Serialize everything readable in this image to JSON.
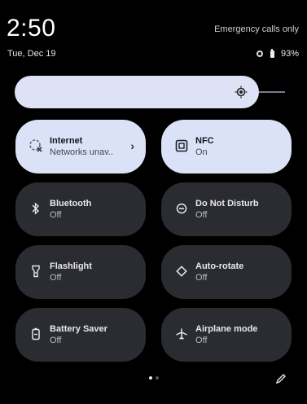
{
  "status": {
    "time": "2:50",
    "date": "Tue, Dec 19",
    "emergency": "Emergency calls only",
    "battery": "93%"
  },
  "brightness": {
    "level": 0.95
  },
  "tiles": [
    {
      "title": "Internet",
      "state": "Networks unav..",
      "active": true,
      "icon": "wifi-off-icon"
    },
    {
      "title": "NFC",
      "state": "On",
      "active": true,
      "icon": "nfc-icon"
    },
    {
      "title": "Bluetooth",
      "state": "Off",
      "active": false,
      "icon": "bluetooth-icon"
    },
    {
      "title": "Do Not Disturb",
      "state": "Off",
      "active": false,
      "icon": "dnd-icon"
    },
    {
      "title": "Flashlight",
      "state": "Off",
      "active": false,
      "icon": "flashlight-icon"
    },
    {
      "title": "Auto-rotate",
      "state": "Off",
      "active": false,
      "icon": "auto-rotate-icon"
    },
    {
      "title": "Battery Saver",
      "state": "Off",
      "active": false,
      "icon": "battery-saver-icon"
    },
    {
      "title": "Airplane mode",
      "state": "Off",
      "active": false,
      "icon": "airplane-icon"
    }
  ],
  "pager": {
    "current": 1,
    "total": 2
  },
  "colors": {
    "tile_on": "#dbe1f6",
    "tile_off": "#2b2c31",
    "background": "#000000"
  }
}
